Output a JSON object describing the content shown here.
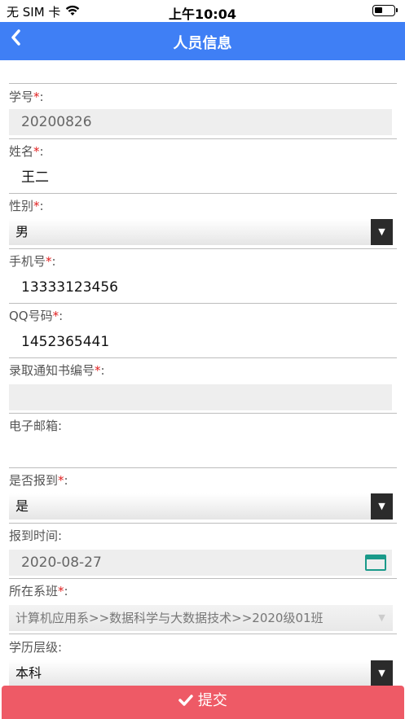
{
  "status_bar": {
    "carrier": "无 SIM 卡",
    "time": "上午10:04"
  },
  "nav": {
    "title": "人员信息",
    "back_label": "<"
  },
  "form": {
    "student_id": {
      "label": "学号",
      "value": "20200826"
    },
    "name": {
      "label": "姓名",
      "value": "王二"
    },
    "gender": {
      "label": "性别",
      "value": "男"
    },
    "phone": {
      "label": "手机号",
      "value": "13333123456"
    },
    "qq": {
      "label": "QQ号码",
      "value": "1452365441"
    },
    "admission_no": {
      "label": "录取通知书编号",
      "value": ""
    },
    "email": {
      "label": "电子邮箱",
      "value": ""
    },
    "reported": {
      "label": "是否报到",
      "value": "是"
    },
    "report_time": {
      "label": "报到时间",
      "value": "2020-08-27"
    },
    "department": {
      "label": "所在系班",
      "value": "计算机应用系>>数据科学与大数据技术>>2020级01班"
    },
    "education": {
      "label": "学历层级",
      "value": "本科"
    }
  },
  "submit": {
    "label": "提交"
  },
  "required_mark": "*",
  "colon": ":",
  "colors": {
    "nav_bg": "#3f7ff5",
    "submit_bg": "#ee5a66",
    "required": "#e02020"
  }
}
